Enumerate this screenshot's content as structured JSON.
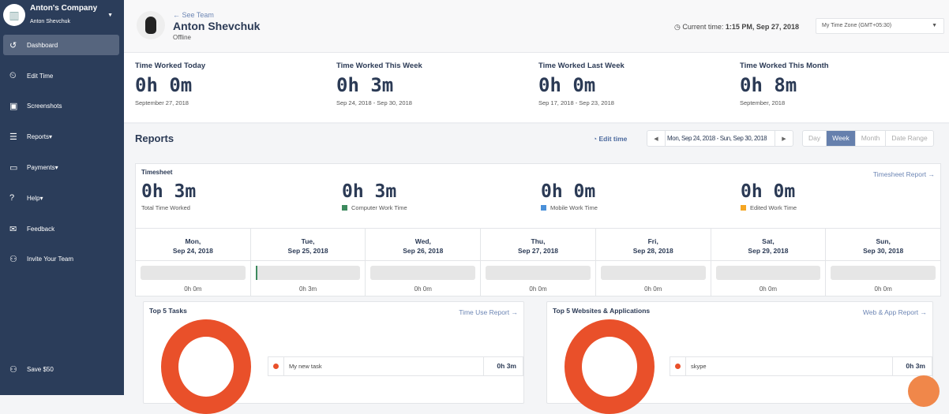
{
  "sidebar": {
    "company": "Anton's Company",
    "user": "Anton Shevchuk",
    "items": [
      {
        "label": "Dashboard",
        "icon": "dashboard-icon"
      },
      {
        "label": "Edit Time",
        "icon": "edit-time-icon"
      },
      {
        "label": "Screenshots",
        "icon": "screenshots-icon"
      },
      {
        "label": "Reports",
        "icon": "reports-icon"
      },
      {
        "label": "Payments",
        "icon": "payments-icon"
      },
      {
        "label": "Help",
        "icon": "help-icon"
      },
      {
        "label": "Feedback",
        "icon": "feedback-icon"
      },
      {
        "label": "Invite Your Team",
        "icon": "invite-icon"
      }
    ],
    "save": "Save $50"
  },
  "header": {
    "see_team": "← See Team",
    "name": "Anton Shevchuk",
    "status": "Offline",
    "current_label": "Current time:",
    "current_time": "1:15 PM, Sep 27, 2018",
    "timezone": "My Time Zone (GMT+05:30)"
  },
  "stats": [
    {
      "title": "Time Worked Today",
      "value": "0h 0m",
      "sub": "September 27, 2018"
    },
    {
      "title": "Time Worked This Week",
      "value": "0h 3m",
      "sub": "Sep 24, 2018 - Sep 30, 2018"
    },
    {
      "title": "Time Worked Last Week",
      "value": "0h 0m",
      "sub": "Sep 17, 2018 - Sep 23, 2018"
    },
    {
      "title": "Time Worked This Month",
      "value": "0h 8m",
      "sub": "September, 2018"
    }
  ],
  "reports": {
    "title": "Reports",
    "edit_time": "Edit time",
    "range": "Mon, Sep 24, 2018 - Sun, Sep 30, 2018",
    "periods": [
      "Day",
      "Week",
      "Month",
      "Date Range"
    ],
    "active_period": "Week"
  },
  "timesheet": {
    "title": "Timesheet",
    "link": "Timesheet Report →",
    "totals": [
      {
        "value": "0h 3m",
        "label": "Total Time Worked",
        "color": ""
      },
      {
        "value": "0h 3m",
        "label": "Computer Work Time",
        "color": "#3d8a5e"
      },
      {
        "value": "0h 0m",
        "label": "Mobile Work Time",
        "color": "#4a90d9"
      },
      {
        "value": "0h 0m",
        "label": "Edited Work Time",
        "color": "#f5a623"
      }
    ],
    "days": [
      {
        "d": "Mon,",
        "date": "Sep 24, 2018",
        "v": "0h 0m",
        "pct": 0
      },
      {
        "d": "Tue,",
        "date": "Sep 25, 2018",
        "v": "0h 3m",
        "pct": 1
      },
      {
        "d": "Wed,",
        "date": "Sep 26, 2018",
        "v": "0h 0m",
        "pct": 0
      },
      {
        "d": "Thu,",
        "date": "Sep 27, 2018",
        "v": "0h 0m",
        "pct": 0
      },
      {
        "d": "Fri,",
        "date": "Sep 28, 2018",
        "v": "0h 0m",
        "pct": 0
      },
      {
        "d": "Sat,",
        "date": "Sep 29, 2018",
        "v": "0h 0m",
        "pct": 0
      },
      {
        "d": "Sun,",
        "date": "Sep 30, 2018",
        "v": "0h 0m",
        "pct": 0
      }
    ]
  },
  "tasks": {
    "title": "Top 5 Tasks",
    "link": "Time Use Report →",
    "items": [
      {
        "label": "My new task",
        "value": "0h 3m"
      }
    ]
  },
  "apps": {
    "title": "Top 5 Websites & Applications",
    "link": "Web & App Report →",
    "items": [
      {
        "label": "skype",
        "value": "0h 3m"
      }
    ]
  },
  "colors": {
    "sidebar": "#2b3d5a",
    "accent": "#6680ad",
    "donut": "#e9502a"
  }
}
